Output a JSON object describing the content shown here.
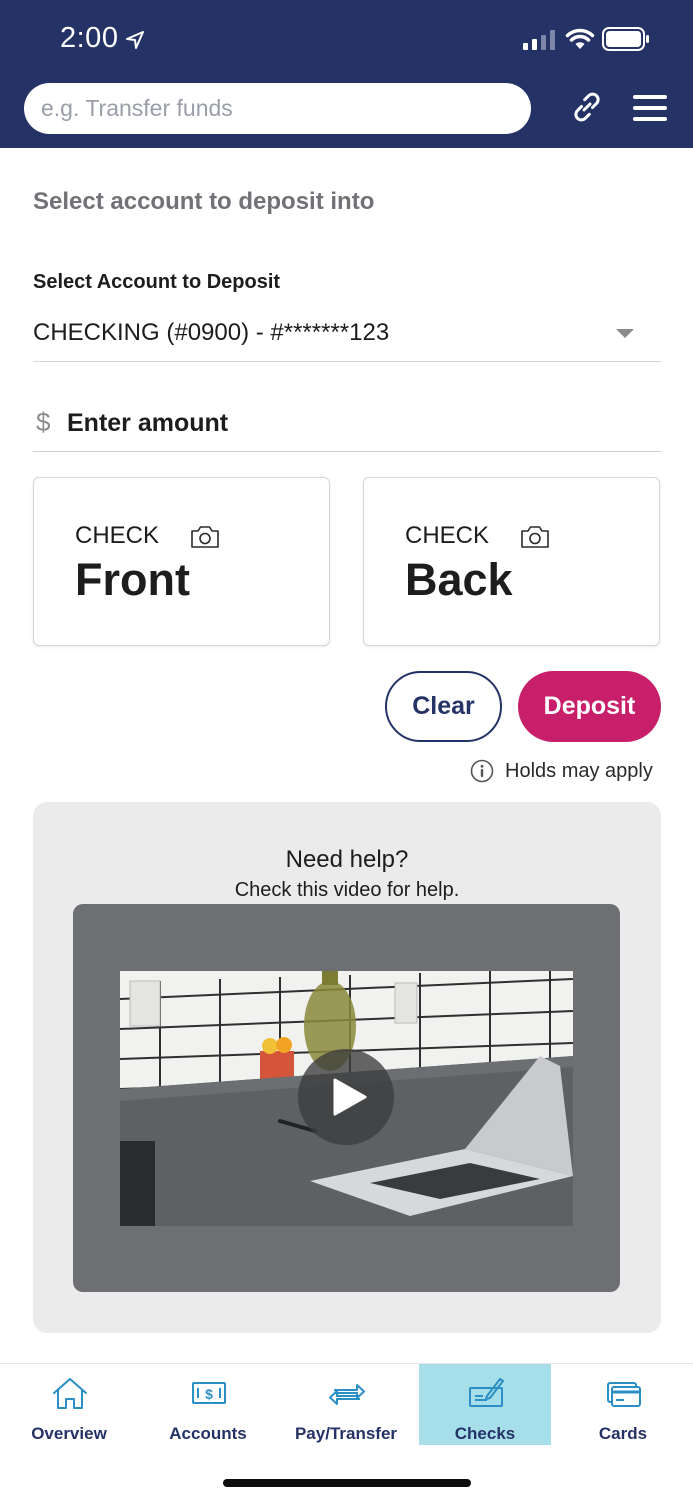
{
  "status_bar": {
    "time": "2:00"
  },
  "header": {
    "search_placeholder": "e.g. Transfer funds",
    "bg_color": "#253266"
  },
  "page": {
    "title": "Select account to deposit into"
  },
  "account": {
    "label": "Select Account to Deposit",
    "selected": "CHECKING (#0900) - #*******123"
  },
  "amount": {
    "currency_symbol": "$",
    "label": "Enter amount"
  },
  "checks": {
    "front": {
      "small": "CHECK",
      "big": "Front"
    },
    "back": {
      "small": "CHECK",
      "big": "Back"
    }
  },
  "actions": {
    "clear_label": "Clear",
    "deposit_label": "Deposit",
    "deposit_color": "#c71f69",
    "holds_text": "Holds may apply"
  },
  "help": {
    "title": "Need help?",
    "subtitle": "Check this video for help."
  },
  "tabbar": {
    "items": [
      {
        "label": "Overview",
        "icon": "home-icon",
        "active": false
      },
      {
        "label": "Accounts",
        "icon": "dollar-bill-icon",
        "active": false
      },
      {
        "label": "Pay/Transfer",
        "icon": "transfer-arrows-icon",
        "active": false
      },
      {
        "label": "Checks",
        "icon": "check-sign-icon",
        "active": true
      },
      {
        "label": "Cards",
        "icon": "credit-card-icon",
        "active": false
      }
    ],
    "active_color": "#a6dfe9"
  }
}
